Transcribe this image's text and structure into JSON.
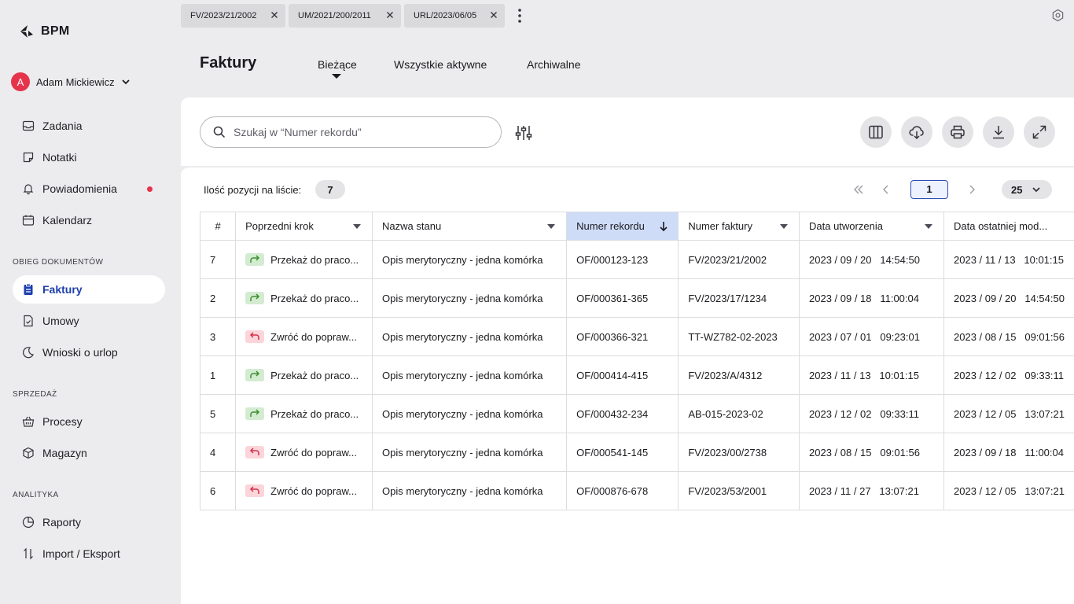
{
  "app": {
    "logo_text": "BPM"
  },
  "user": {
    "initial": "A",
    "name": "Adam Mickiewicz"
  },
  "sidebar": {
    "top_items": [
      {
        "label": "Zadania",
        "icon": "inbox-icon"
      },
      {
        "label": "Notatki",
        "icon": "note-icon"
      },
      {
        "label": "Powiadomienia",
        "icon": "bell-icon",
        "has_dot": true
      },
      {
        "label": "Kalendarz",
        "icon": "calendar-icon"
      }
    ],
    "sections": [
      {
        "label": "OBIEG DOKUMENTÓW",
        "items": [
          {
            "label": "Faktury",
            "icon": "clipboard-icon",
            "active": true
          },
          {
            "label": "Umowy",
            "icon": "document-check-icon"
          },
          {
            "label": "Wnioski o urlop",
            "icon": "moon-icon"
          }
        ]
      },
      {
        "label": "SPRZEDAŻ",
        "items": [
          {
            "label": "Procesy",
            "icon": "basket-icon"
          },
          {
            "label": "Magazyn",
            "icon": "box-icon"
          }
        ]
      },
      {
        "label": "ANALITYKA",
        "items": [
          {
            "label": "Raporty",
            "icon": "pie-chart-icon"
          },
          {
            "label": "Import / Eksport",
            "icon": "arrows-up-down-icon"
          }
        ]
      }
    ]
  },
  "doc_tabs": [
    {
      "label": "FV/2023/21/2002"
    },
    {
      "label": "UM/2021/200/2011"
    },
    {
      "label": "URL/2023/06/05"
    }
  ],
  "page": {
    "title": "Faktury",
    "view_tabs": [
      {
        "label": "Bieżące",
        "active": true
      },
      {
        "label": "Wszystkie aktywne"
      },
      {
        "label": "Archiwalne"
      }
    ]
  },
  "search": {
    "placeholder": "Szukaj w “Numer rekordu”",
    "value": ""
  },
  "toolbar": {
    "buttons": [
      "columns-icon",
      "cloud-download-icon",
      "printer-icon",
      "download-icon",
      "expand-icon"
    ]
  },
  "list": {
    "count_label": "Ilość pozycji na liście:",
    "count": "7",
    "current_page": "1",
    "page_size": "25"
  },
  "table": {
    "columns": [
      "#",
      "Poprzedni krok",
      "Nazwa stanu",
      "Numer rekordu",
      "Numer faktury",
      "Data utworzenia",
      "Data ostatniej mod..."
    ],
    "sorted_column": "Numer rekordu",
    "rows": [
      {
        "num": "7",
        "step_type": "forward",
        "step": "Przekaż do praco...",
        "state": "Opis merytoryczny - jedna komórka",
        "record": "OF/000123-123",
        "invoice": "FV/2023/21/2002",
        "created": "2023 / 09 / 20   14:54:50",
        "modified": "2023 / 11 / 13   10:01:15"
      },
      {
        "num": "2",
        "step_type": "forward",
        "step": "Przekaż do praco...",
        "state": "Opis merytoryczny - jedna komórka",
        "record": "OF/000361-365",
        "invoice": "FV/2023/17/1234",
        "created": "2023 / 09 / 18   11:00:04",
        "modified": "2023 / 09 / 20   14:54:50"
      },
      {
        "num": "3",
        "step_type": "back",
        "step": "Zwróć do popraw...",
        "state": "Opis merytoryczny - jedna komórka",
        "record": "OF/000366-321",
        "invoice": "TT-WZ782-02-2023",
        "created": "2023 / 07 / 01   09:23:01",
        "modified": "2023 / 08 / 15   09:01:56"
      },
      {
        "num": "1",
        "step_type": "forward",
        "step": "Przekaż do praco...",
        "state": "Opis merytoryczny - jedna komórka",
        "record": "OF/000414-415",
        "invoice": "FV/2023/A/4312",
        "created": "2023 / 11 / 13   10:01:15",
        "modified": "2023 / 12 / 02   09:33:11"
      },
      {
        "num": "5",
        "step_type": "forward",
        "step": "Przekaż do praco...",
        "state": "Opis merytoryczny - jedna komórka",
        "record": "OF/000432-234",
        "invoice": "AB-015-2023-02",
        "created": "2023 / 12 / 02   09:33:11",
        "modified": "2023 / 12 / 05   13:07:21"
      },
      {
        "num": "4",
        "step_type": "back",
        "step": "Zwróć do popraw...",
        "state": "Opis merytoryczny - jedna komórka",
        "record": "OF/000541-145",
        "invoice": "FV/2023/00/2738",
        "created": "2023 / 08 / 15   09:01:56",
        "modified": "2023 / 09 / 18   11:00:04"
      },
      {
        "num": "6",
        "step_type": "back",
        "step": "Zwróć do popraw...",
        "state": "Opis merytoryczny - jedna komórka",
        "record": "OF/000876-678",
        "invoice": "FV/2023/53/2001",
        "created": "2023 / 11 / 27   13:07:21",
        "modified": "2023 / 12 / 05   13:07:21"
      }
    ]
  },
  "colors": {
    "accent": "#1e3fae",
    "alert": "#e5334b",
    "sorted_header": "#cfdcf8",
    "forward_bg": "#d3ecd1",
    "back_bg": "#fbd5da"
  }
}
